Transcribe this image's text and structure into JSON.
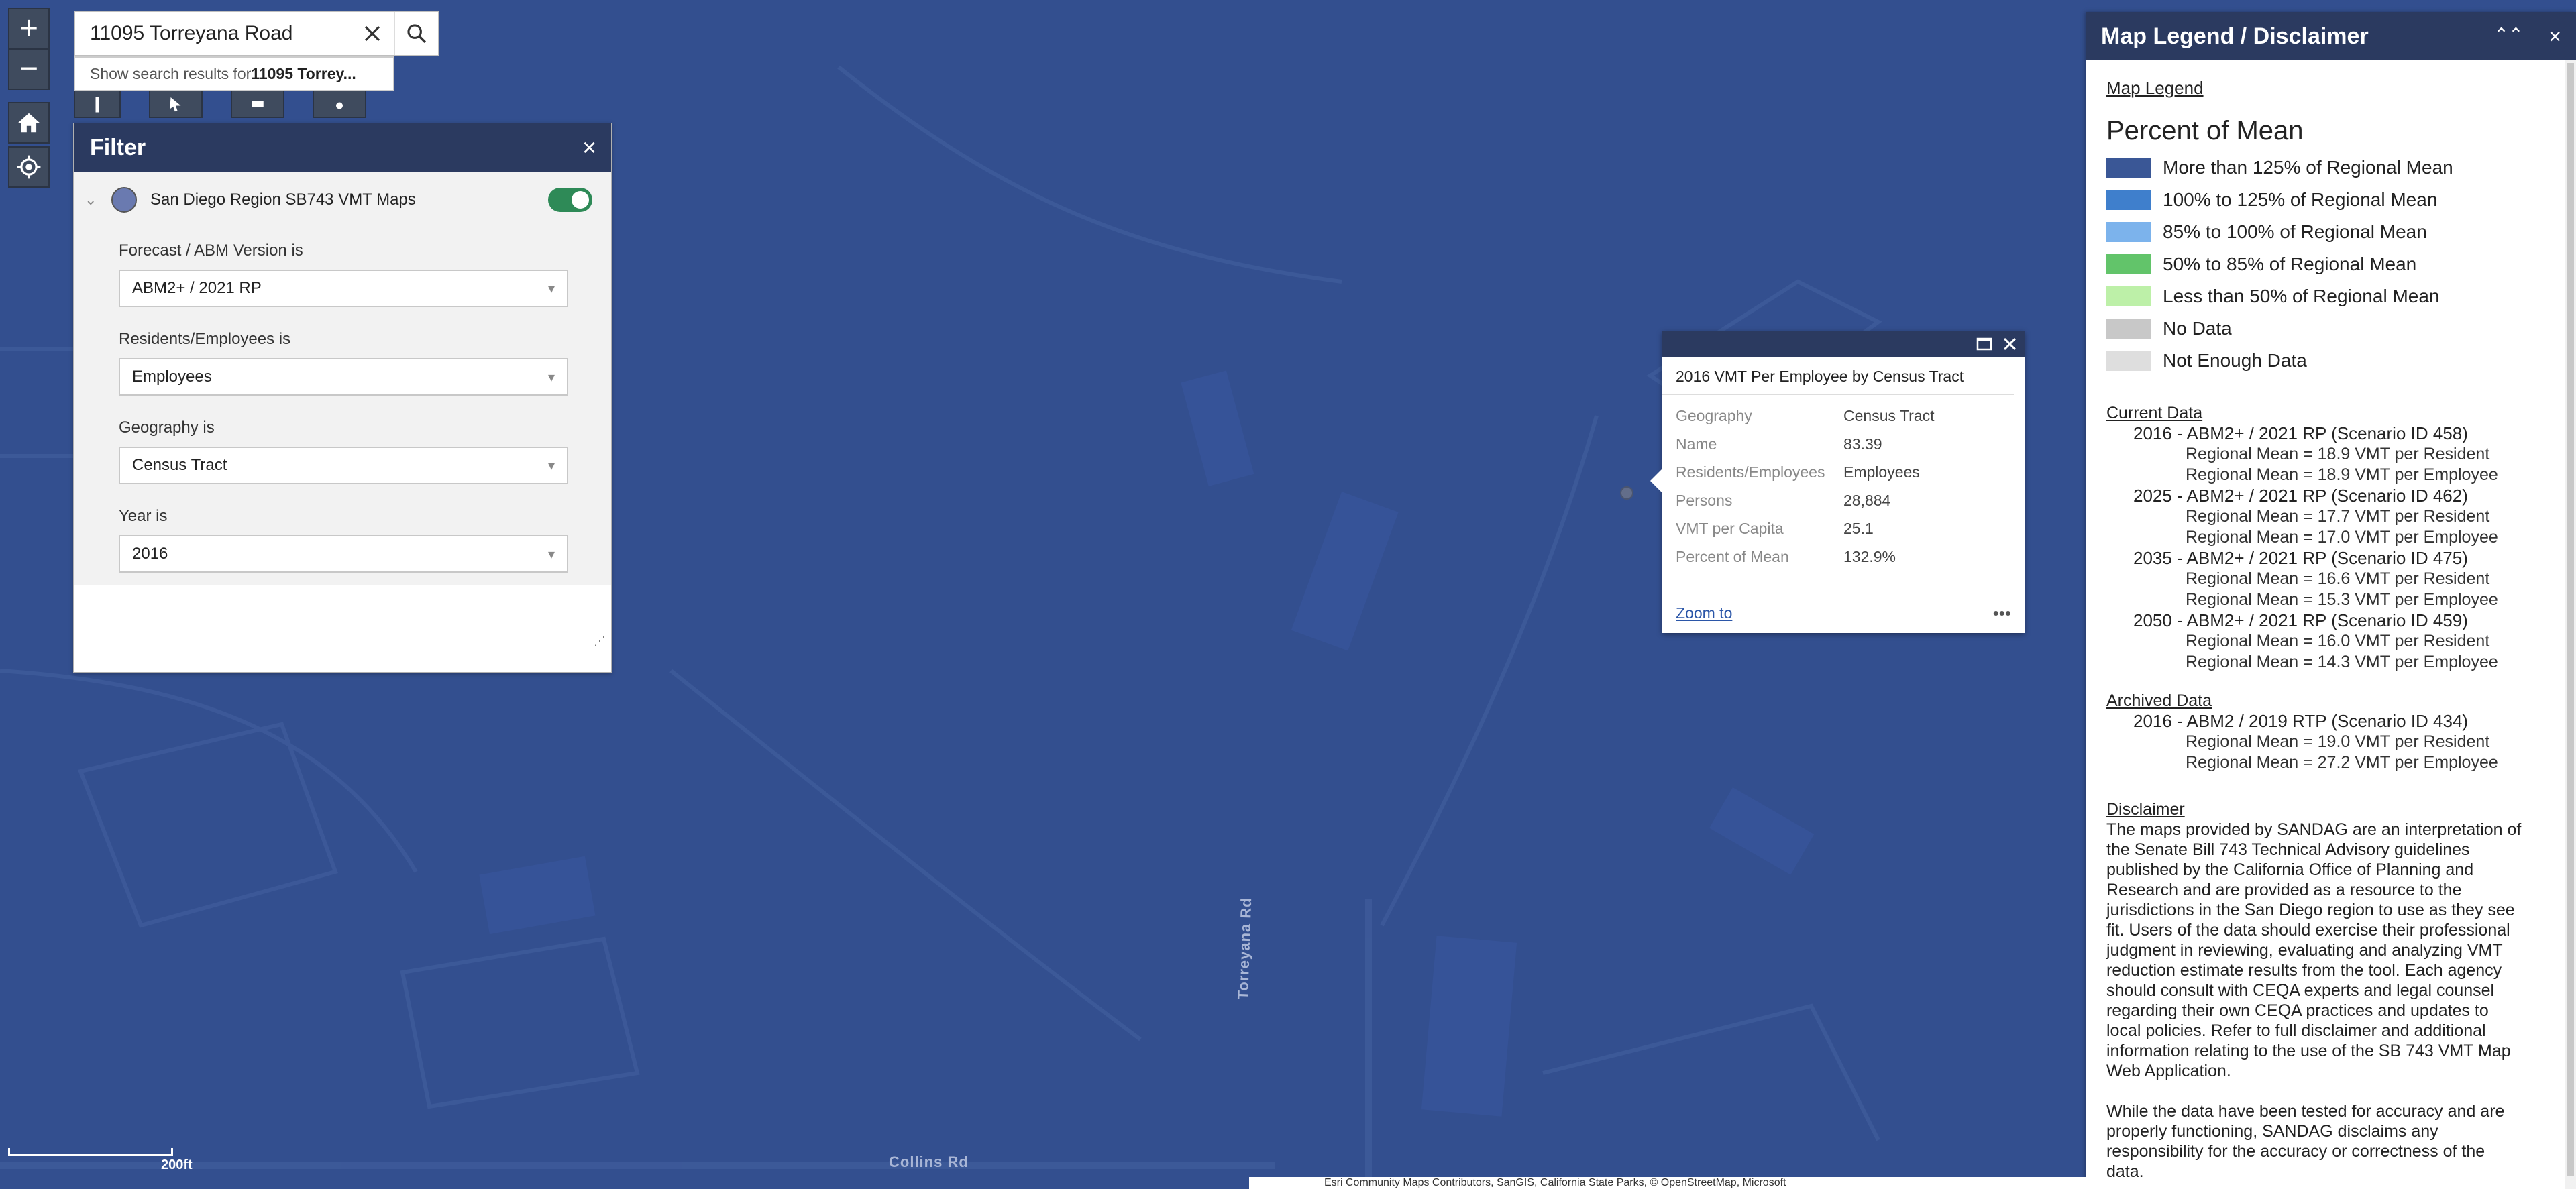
{
  "search": {
    "value": "11095 Torreyana Road",
    "hint_prefix": "Show search results for ",
    "hint_bold": "11095 Torrey..."
  },
  "controls": {
    "zoom_in": "+",
    "zoom_out": "−"
  },
  "filter": {
    "title": "Filter",
    "close": "×",
    "layer_name": "San Diego Region SB743 VMT Maps",
    "layer_enabled": true,
    "fields": [
      {
        "label": "Forecast / ABM Version is",
        "value": "ABM2+ / 2021 RP"
      },
      {
        "label": "Residents/Employees is",
        "value": "Employees"
      },
      {
        "label": "Geography is",
        "value": "Census Tract"
      },
      {
        "label": "Year is",
        "value": "2016"
      }
    ]
  },
  "popup": {
    "title": "2016 VMT Per Employee by Census Tract",
    "rows": [
      {
        "key": "Geography",
        "value": "Census Tract"
      },
      {
        "key": "Name",
        "value": "83.39"
      },
      {
        "key": "Residents/Employees",
        "value": "Employees"
      },
      {
        "key": "Persons",
        "value": "28,884"
      },
      {
        "key": "VMT per Capita",
        "value": "25.1"
      },
      {
        "key": "Percent of Mean",
        "value": "132.9%"
      }
    ],
    "zoom_label": "Zoom to",
    "more_label": "•••"
  },
  "legend": {
    "title": "Map Legend / Disclaimer",
    "collapse_icon": "⌃⌃",
    "close": "×",
    "map_legend_label": "Map Legend",
    "percent_title": "Percent of Mean",
    "items": [
      {
        "label": "More than 125% of Regional Mean",
        "color": "#3a5796"
      },
      {
        "label": "100% to 125% of Regional Mean",
        "color": "#3f7fcc"
      },
      {
        "label": "85% to 100% of Regional Mean",
        "color": "#7cb3ec"
      },
      {
        "label": "50% to 85% of Regional Mean",
        "color": "#62c46a"
      },
      {
        "label": "Less than 50% of Regional Mean",
        "color": "#bdf0a8"
      },
      {
        "label": "No Data",
        "color": "#c8c8c8"
      },
      {
        "label": "Not Enough Data",
        "color": "#dedede"
      }
    ],
    "current_label": "Current Data",
    "current": [
      {
        "scenario": "2016 - ABM2+ / 2021 RP (Scenario ID 458)",
        "means": [
          "Regional Mean = 18.9 VMT per Resident",
          "Regional Mean = 18.9 VMT per Employee"
        ]
      },
      {
        "scenario": "2025 - ABM2+ / 2021 RP (Scenario ID 462)",
        "means": [
          "Regional Mean = 17.7 VMT per Resident",
          "Regional Mean = 17.0 VMT per Employee"
        ]
      },
      {
        "scenario": "2035 - ABM2+ / 2021 RP (Scenario ID 475)",
        "means": [
          "Regional Mean = 16.6 VMT per Resident",
          "Regional Mean = 15.3 VMT per Employee"
        ]
      },
      {
        "scenario": "2050 - ABM2+ / 2021 RP (Scenario ID 459)",
        "means": [
          "Regional Mean = 16.0 VMT per Resident",
          "Regional Mean = 14.3 VMT per Employee"
        ]
      }
    ],
    "archived_label": "Archived Data",
    "archived": [
      {
        "scenario": "2016 - ABM2 / 2019 RTP (Scenario ID 434)",
        "means": [
          "Regional Mean = 19.0 VMT per Resident",
          "Regional Mean = 27.2 VMT per Employee"
        ]
      }
    ],
    "disclaimer_label": "Disclaimer",
    "disclaimer_text": "The maps provided by SANDAG are an interpretation of the Senate Bill 743 Technical Advisory guidelines published by the California Office of Planning and Research and are provided as a resource to the jurisdictions in the San Diego region to use as they see fit. Users of the data should exercise their professional judgment in reviewing, evaluating and analyzing VMT reduction estimate results from the tool. Each agency should consult with CEQA experts and legal counsel regarding their own CEQA practices and updates to local policies. Refer to full disclaimer and additional information relating to the use of the SB 743 VMT Map Web Application.",
    "disclaimer_text2": "While the data have been tested for accuracy and are properly functioning, SANDAG disclaims any responsibility for the accuracy or correctness of the data."
  },
  "map": {
    "scale_label": "200ft",
    "road_label_1": "Collins Rd",
    "road_label_2": "Torreyana Rd",
    "attribution": "Esri Community Maps Contributors, SanGIS, California State Parks, © OpenStreetMap, Microsoft"
  }
}
